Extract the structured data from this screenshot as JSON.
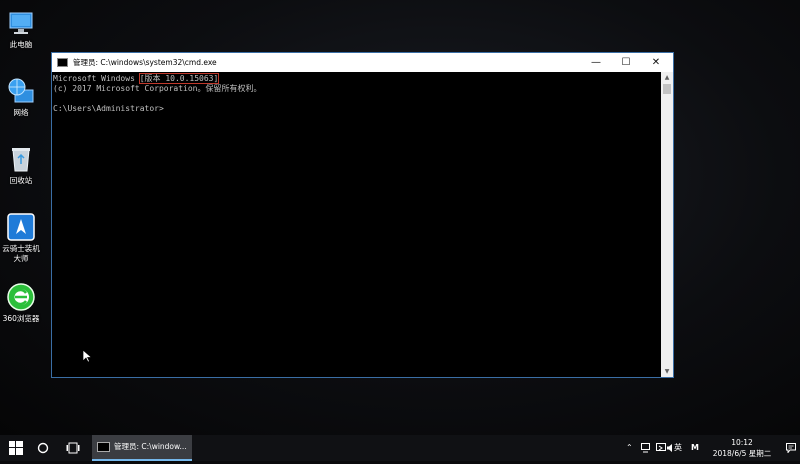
{
  "desktop": {
    "icons": [
      {
        "label": "此电脑"
      },
      {
        "label": "网络"
      },
      {
        "label": "回收站"
      },
      {
        "label_line1": "云骑士装机",
        "label_line2": "大师"
      },
      {
        "label": "360浏览器"
      }
    ]
  },
  "window": {
    "title": "管理员: C:\\windows\\system32\\cmd.exe",
    "minimize": "—",
    "maximize": "☐",
    "close": "✕",
    "console": {
      "line1_prefix": "Microsoft Windows ",
      "line1_version": "[版本 10.0.15063]",
      "line2": "(c) 2017 Microsoft Corporation。保留所有权利。",
      "line3": "C:\\Users\\Administrator>"
    }
  },
  "taskbar": {
    "app_label": "管理员: C:\\window...",
    "ime_label": "英",
    "ime_mode": "M",
    "time": "10:12",
    "date": "2018/6/5 星期二"
  },
  "colors": {
    "accent": "#76b9ed",
    "window_border": "#3a6ea5",
    "console_text": "#c0c0c0",
    "highlight_box": "#c0392b"
  }
}
